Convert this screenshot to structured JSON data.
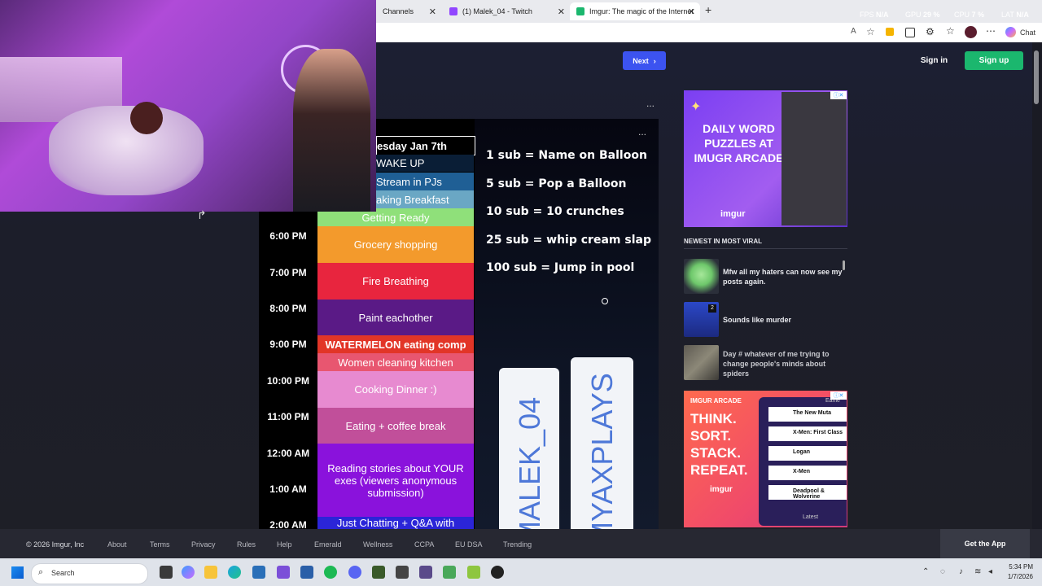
{
  "browser": {
    "tabs": [
      {
        "label": "Channels"
      },
      {
        "label": "(1) Malek_04 - Twitch"
      },
      {
        "label": "Imgur: The magic of the Internet"
      }
    ],
    "new_tab": "+",
    "chat_label": "Chat",
    "stats": [
      {
        "name": "FPS",
        "value": "N/A"
      },
      {
        "name": "GPU",
        "value": "29 %"
      },
      {
        "name": "CPU",
        "value": "7 %"
      },
      {
        "name": "LAT",
        "value": "N/A"
      }
    ]
  },
  "imgur": {
    "next_label": "Next",
    "signin_label": "Sign in",
    "signup_label": "Sign up",
    "menu_dots": "...",
    "schedule": {
      "day_header": "esday Jan 7th",
      "rows": [
        {
          "label": "WAKE UP",
          "color": "#0a1e36"
        },
        {
          "label": "Stream in PJs",
          "color": "#1f5f95"
        },
        {
          "label": "aking Breakfast",
          "color": "#6aa7c4"
        },
        {
          "label": "Getting Ready",
          "color": "#8fe07a"
        },
        {
          "label": "Grocery shopping",
          "color": "#f39a2c"
        },
        {
          "label": "Fire Breathing",
          "color": "#e8253e"
        },
        {
          "label": "Paint eachother",
          "color": "#5a1a86"
        },
        {
          "label": "WATERMELON eating comp",
          "color": "#e23527"
        },
        {
          "label": "Women cleaning kitchen",
          "color": "#e85670"
        },
        {
          "label": "Cooking Dinner :)",
          "color": "#e78ad0"
        },
        {
          "label": "Eating + coffee break",
          "color": "#c14f9a"
        },
        {
          "label": "Reading stories about YOUR exes (viewers anonymous submission)",
          "color": "#8a12dc"
        },
        {
          "label": "Just Chatting + Q&A with",
          "color": "#2b25d8"
        }
      ],
      "times": [
        "6:00 PM",
        "7:00 PM",
        "8:00 PM",
        "9:00 PM",
        "10:00 PM",
        "11:00 PM",
        "12:00 AM",
        "1:00 AM",
        "2:00 AM"
      ],
      "sub_goals": [
        "1 sub = Name on Balloon",
        "5 sub = Pop a Balloon",
        "10 sub = 10 crunches",
        "25 sub = whip cream slap",
        "100 sub = Jump in pool"
      ],
      "handles": [
        "/MALEK_04",
        "/MYAXPLAYS"
      ]
    },
    "ad1": {
      "title": "DAILY WORD PUZZLES AT IMUGR ARCADE",
      "brand": "imgur"
    },
    "viral": {
      "header": "NEWEST IN MOST VIRAL",
      "items": [
        {
          "title": "Mfw all my haters can now see my posts again."
        },
        {
          "title": "Sounds like murder",
          "badge": "2"
        },
        {
          "title": "Day # whatever of me trying to change people's minds about spiders"
        }
      ]
    },
    "ad2": {
      "kicker": "IMGUR ARCADE",
      "title": "THINK. SORT. STACK. REPEAT.",
      "brand": "imgur",
      "cards": [
        "The New Muta",
        "X-Men: First Class",
        "Logan",
        "X-Men",
        "Deadpool & Wolverine"
      ],
      "latest": "Latest",
      "earliest": "Earlie"
    },
    "footer": {
      "copyright": "© 2026 Imgur, Inc",
      "links": [
        "About",
        "Terms",
        "Privacy",
        "Rules",
        "Help",
        "Emerald",
        "Wellness",
        "CCPA",
        "EU DSA",
        "Trending"
      ],
      "get_app": "Get the App"
    }
  },
  "taskbar": {
    "search_label": "Search",
    "time": "5:34 PM",
    "date": "1/7/2026"
  }
}
